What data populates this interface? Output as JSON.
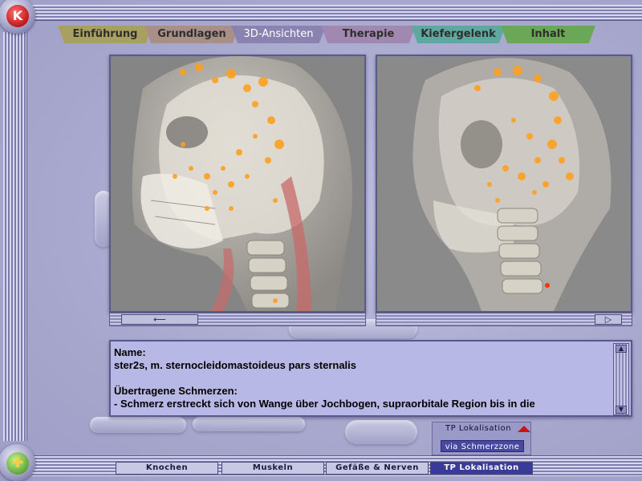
{
  "app": {
    "logo_glyph": "K",
    "nav_glyph": "✚"
  },
  "tabs": [
    {
      "label": "Einführung",
      "color": "#a8a060"
    },
    {
      "label": "Grundlagen",
      "color": "#a89088"
    },
    {
      "label": "3D-Ansichten",
      "color": "#8a82b0",
      "active": true
    },
    {
      "label": "Therapie",
      "color": "#a088b0"
    },
    {
      "label": "Kiefergelenk",
      "color": "#5fa8a0"
    },
    {
      "label": "Inhalt",
      "color": "#6aa858"
    }
  ],
  "panes": {
    "left": {
      "icon": "skull-side-view",
      "scroll_arrow": "⟵"
    },
    "right": {
      "icon": "skull-oblique-view",
      "scroll_arrow": "▷"
    }
  },
  "info": {
    "lines": [
      "Name:",
      "ster2s, m. sternocleidomastoideus pars sternalis",
      "",
      "Übertragene Schmerzen:",
      "- Schmerz erstreckt sich von Wange über Jochbogen, supraorbitale Region bis in die"
    ],
    "scroll_up": "▲",
    "scroll_down": "▼"
  },
  "tp_menu": {
    "header": "TP Lokalisation",
    "item": "via Schmerzzone",
    "arrow_color": "#d01010"
  },
  "bottom_nav": [
    {
      "label": "Knochen"
    },
    {
      "label": "Muskeln"
    },
    {
      "label": "Gefäße & Nerven"
    },
    {
      "label": "TP Lokalisation",
      "active": true
    }
  ]
}
